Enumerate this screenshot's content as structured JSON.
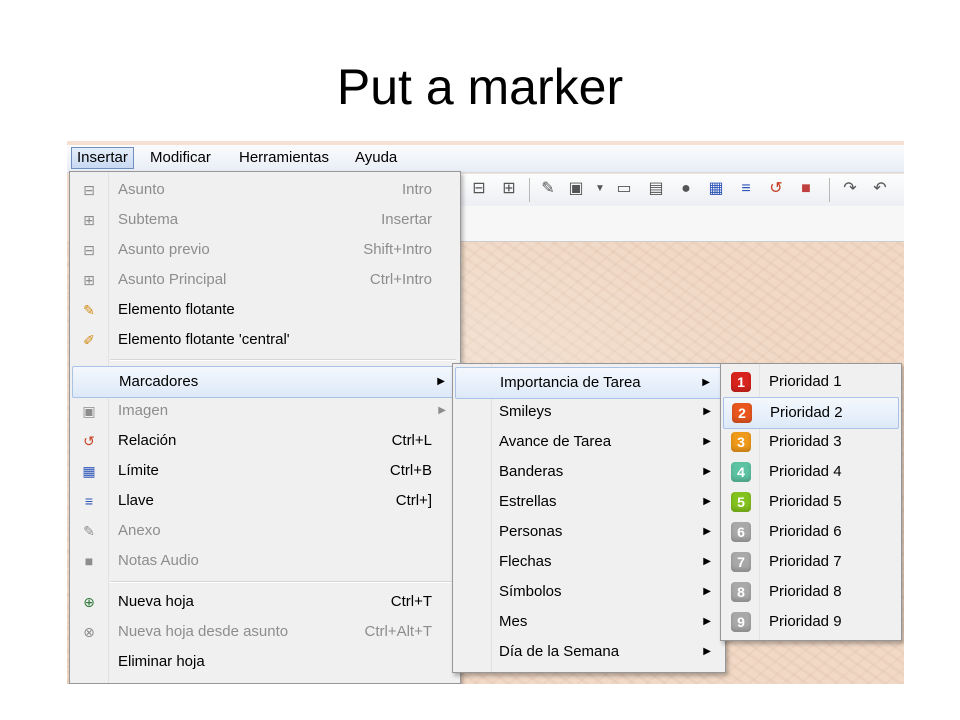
{
  "slide": {
    "title": "Put a marker"
  },
  "menubar": {
    "items": [
      "Insertar",
      "Modificar",
      "Herramientas",
      "Ayuda"
    ]
  },
  "insert_menu": {
    "items": [
      {
        "label": "Asunto",
        "shortcut": "Intro",
        "enabled": false,
        "icon": "topic-icon"
      },
      {
        "label": "Subtema",
        "shortcut": "Insertar",
        "enabled": false,
        "icon": "subtopic-icon"
      },
      {
        "label": "Asunto previo",
        "shortcut": "Shift+Intro",
        "enabled": false,
        "icon": "previous-topic-icon"
      },
      {
        "label": "Asunto Principal",
        "shortcut": "Ctrl+Intro",
        "enabled": false,
        "icon": "main-topic-icon"
      },
      {
        "label": "Elemento flotante",
        "shortcut": "",
        "enabled": true,
        "icon": "floating-element-icon"
      },
      {
        "label": "Elemento flotante 'central'",
        "shortcut": "",
        "enabled": true,
        "icon": "central-floating-icon"
      },
      {
        "label": "Marcadores",
        "shortcut": "",
        "enabled": true,
        "submenu": true,
        "highlighted": true
      },
      {
        "label": "Imagen",
        "shortcut": "",
        "enabled": false,
        "submenu": true,
        "icon": "image-icon"
      },
      {
        "label": "Relación",
        "shortcut": "Ctrl+L",
        "enabled": true,
        "icon": "relationship-icon"
      },
      {
        "label": "Límite",
        "shortcut": "Ctrl+B",
        "enabled": true,
        "icon": "boundary-icon"
      },
      {
        "label": "Llave",
        "shortcut": "Ctrl+]",
        "enabled": true,
        "icon": "brace-icon"
      },
      {
        "label": "Anexo",
        "shortcut": "",
        "enabled": false,
        "icon": "attachment-icon"
      },
      {
        "label": "Notas Audio",
        "shortcut": "",
        "enabled": false,
        "icon": "audio-notes-icon"
      },
      {
        "label": "Nueva hoja",
        "shortcut": "Ctrl+T",
        "enabled": true,
        "icon": "new-sheet-icon"
      },
      {
        "label": "Nueva hoja desde asunto",
        "shortcut": "Ctrl+Alt+T",
        "enabled": false,
        "icon": "sheet-from-topic-icon"
      },
      {
        "label": "Eliminar hoja",
        "shortcut": "",
        "enabled": true
      }
    ]
  },
  "markers_menu": {
    "items": [
      "Importancia de Tarea",
      "Smileys",
      "Avance de Tarea",
      "Banderas",
      "Estrellas",
      "Personas",
      "Flechas",
      "Símbolos",
      "Mes",
      "Día de la Semana"
    ],
    "highlighted": "Importancia de Tarea"
  },
  "priority_menu": {
    "items": [
      {
        "num": "1",
        "label": "Prioridad 1",
        "color": "#d9231d"
      },
      {
        "num": "2",
        "label": "Prioridad 2",
        "color": "#e9571e"
      },
      {
        "num": "3",
        "label": "Prioridad 3",
        "color": "#ef9a1a"
      },
      {
        "num": "4",
        "label": "Prioridad 4",
        "color": "#5dc3a3"
      },
      {
        "num": "5",
        "label": "Prioridad 5",
        "color": "#84c21e"
      },
      {
        "num": "6",
        "label": "Prioridad 6",
        "color": "#a9a9a9"
      },
      {
        "num": "7",
        "label": "Prioridad 7",
        "color": "#a9a9a9"
      },
      {
        "num": "8",
        "label": "Prioridad 8",
        "color": "#a9a9a9"
      },
      {
        "num": "9",
        "label": "Prioridad 9",
        "color": "#a9a9a9"
      }
    ],
    "highlighted": "Prioridad 2"
  },
  "arrow_glyph": "▶"
}
